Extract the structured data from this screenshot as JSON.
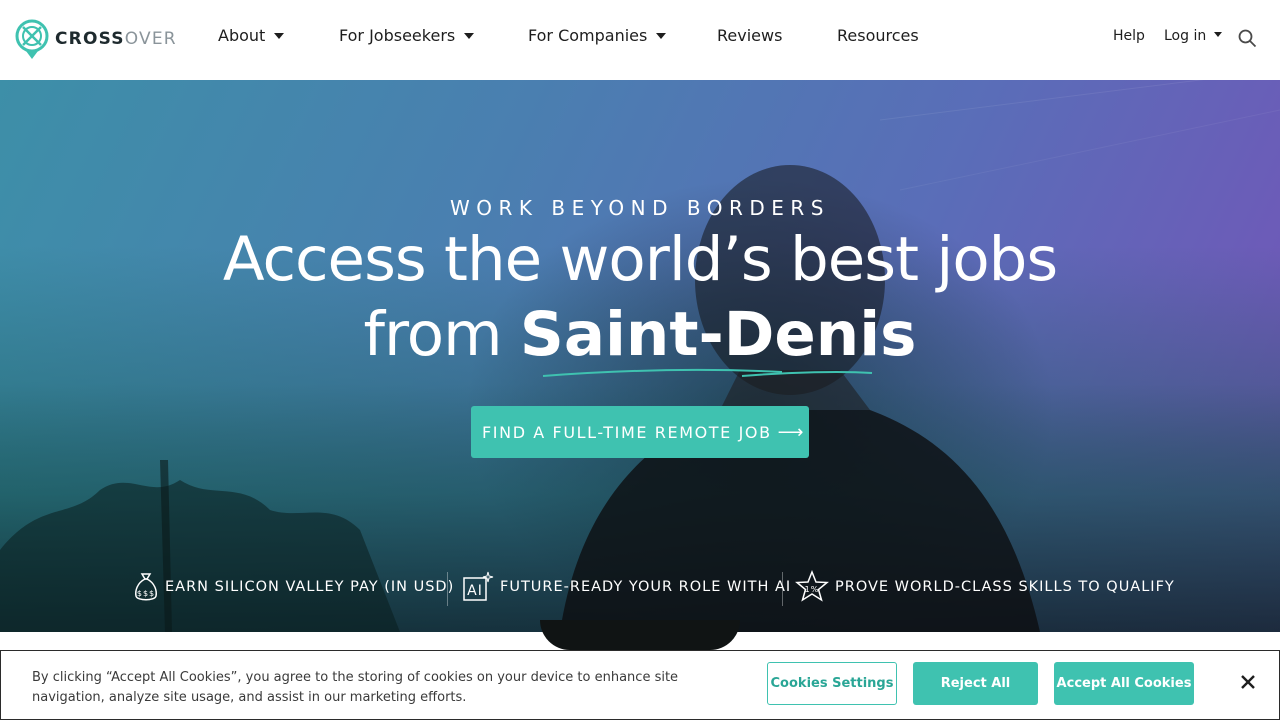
{
  "logo": {
    "part1": "CROSS",
    "part2": "OVER"
  },
  "nav": {
    "items": [
      {
        "label": "About",
        "dropdown": true
      },
      {
        "label": "For Jobseekers",
        "dropdown": true
      },
      {
        "label": "For Companies",
        "dropdown": true
      },
      {
        "label": "Reviews",
        "dropdown": false
      },
      {
        "label": "Resources",
        "dropdown": false
      }
    ],
    "help": "Help",
    "login": "Log in",
    "search_icon": "search-icon"
  },
  "hero": {
    "kicker": "WORK BEYOND BORDERS",
    "line1": "Access the world’s best jobs",
    "line2_prefix": "from",
    "city": "Saint-Denis",
    "cta": "FIND A FULL-TIME REMOTE JOB",
    "cta_icon": "arrow-right-icon"
  },
  "features": [
    {
      "icon": "money-bag-icon",
      "label": "EARN SILICON VALLEY PAY (IN USD)"
    },
    {
      "icon": "ai-sparkle-icon",
      "label": "FUTURE-READY YOUR ROLE WITH AI"
    },
    {
      "icon": "star-badge-icon",
      "label": "PROVE WORLD-CLASS SKILLS TO QUALIFY"
    }
  ],
  "cookie": {
    "text": "By clicking “Accept All Cookies”, you agree to the storing of cookies on your device to enhance site navigation, analyze site usage, and assist in our marketing efforts.",
    "settings": "Cookies Settings",
    "reject": "Reject All",
    "accept": "Accept All Cookies"
  },
  "colors": {
    "accent": "#3fc2b0",
    "text": "#1e1e1e"
  }
}
